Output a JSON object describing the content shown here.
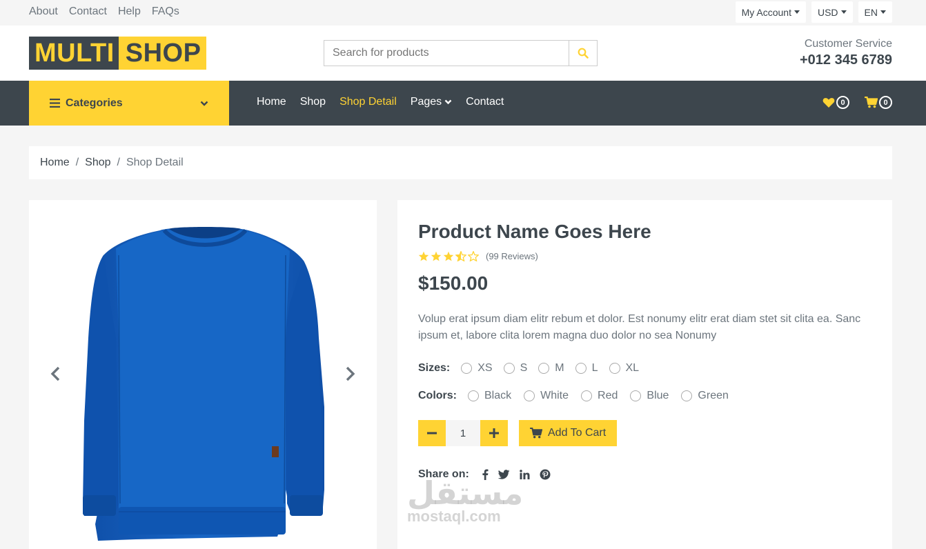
{
  "topbar": {
    "links": [
      "About",
      "Contact",
      "Help",
      "FAQs"
    ],
    "dropdowns": [
      "My Account",
      "USD",
      "EN"
    ]
  },
  "header": {
    "logo_part1": "MULTI",
    "logo_part2": "SHOP",
    "search_placeholder": "Search for products",
    "customer_service_label": "Customer Service",
    "phone": "+012 345 6789"
  },
  "nav": {
    "categories_label": "Categories",
    "menu": [
      "Home",
      "Shop",
      "Shop Detail",
      "Pages",
      "Contact"
    ],
    "active_item": "Shop Detail",
    "wishlist_count": "0",
    "cart_count": "0"
  },
  "breadcrumb": [
    "Home",
    "Shop",
    "Shop Detail"
  ],
  "product": {
    "name": "Product Name Goes Here",
    "rating": 3.5,
    "reviews": "(99 Reviews)",
    "price": "$150.00",
    "description": "Volup erat ipsum diam elitr rebum et dolor. Est nonumy elitr erat diam stet sit clita ea. Sanc ipsum et, labore clita lorem magna duo dolor no sea Nonumy",
    "sizes_label": "Sizes:",
    "sizes": [
      "XS",
      "S",
      "M",
      "L",
      "XL"
    ],
    "colors_label": "Colors:",
    "colors": [
      "Black",
      "White",
      "Red",
      "Blue",
      "Green"
    ],
    "quantity": "1",
    "add_to_cart": "Add To Cart",
    "share_label": "Share on:"
  },
  "watermark": {
    "arabic": "مستقل",
    "latin": "mostaql.com"
  },
  "theme": {
    "accent": "#ffd333",
    "dark": "#3d464d",
    "product_color": "#1560bd"
  }
}
